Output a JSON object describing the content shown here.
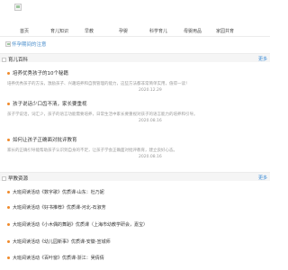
{
  "header": {
    "logo_icon": "broken-image-icon",
    "link": ""
  },
  "nav": {
    "items": [
      "首页",
      "育儿知识",
      "早教",
      "孕婴",
      "科学育儿",
      "母婴用品",
      "家园共育"
    ]
  },
  "banner": {
    "alt_text": "怀孕期间的注意",
    "icon": "broken-image-icon"
  },
  "section1": {
    "title": "育儿百科",
    "more": "更多",
    "articles": [
      {
        "title": "培养优秀孩子的10个秘籍",
        "summary": "培养优秀孩子的方法，激励孩子、兴趣培养和自我管理的能力，这些方法都非常简单实用，值得一读！",
        "date": "2020.12.29"
      },
      {
        "title": "孩子说话少口齿不清，家长要重视",
        "summary": "孩子学说话，词汇少，孩子的语言功能需要培养，日常生活中家长要重视对孩子的语言能力的培养和引导。",
        "date": "2020.08.16"
      },
      {
        "title": "如何让孩子正确面对批评教育",
        "summary": "家长的正确引导能帮助孩子认识到自身的不足，让孩子学会正确面对批评教育，建立良好心态。",
        "date": "2020.08.16"
      }
    ]
  },
  "section2": {
    "title": "早教资源",
    "more": "更多",
    "items": [
      "大班阅读活动《数字歌》优质课-山东：杜乃妮",
      "大班阅读活动《好书推荐》优质课-河北-石淑芳",
      "大班阅读活动《小木偶的舞蹈》优质课（上海市幼教学研会，嘉宝）",
      "大班阅读活动《幼儿园新事》优质课-安徽-宣城师",
      "大班阅读活动《百叶窗》优质课-浙江：吴倩倩"
    ]
  }
}
